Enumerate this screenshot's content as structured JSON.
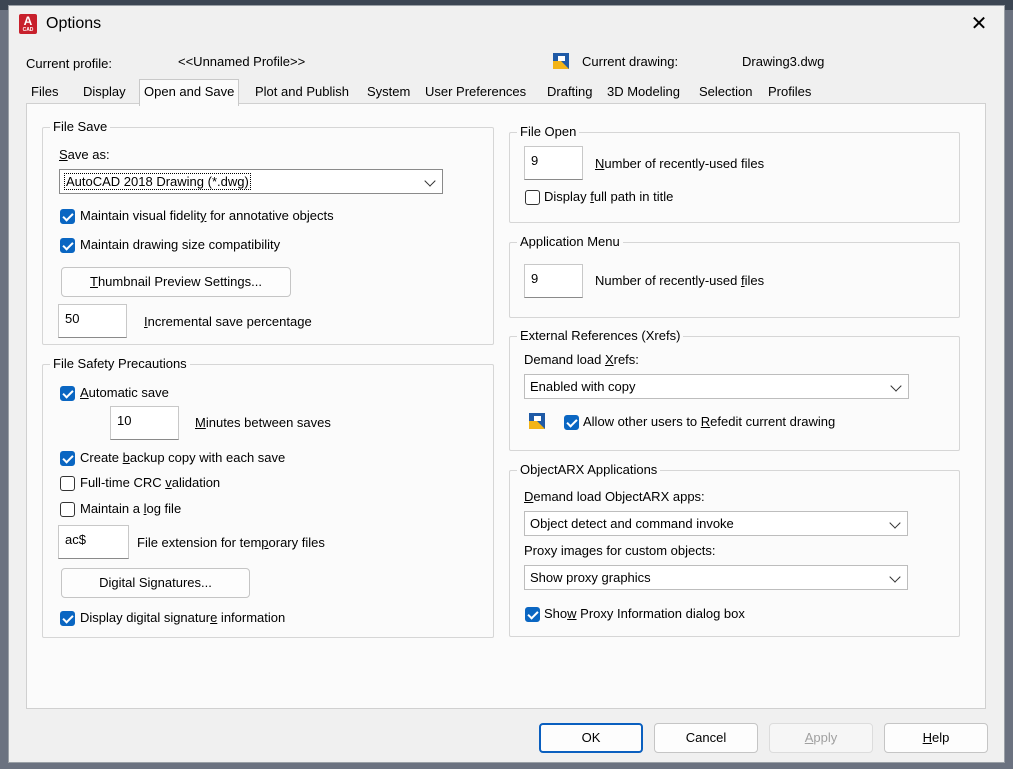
{
  "window": {
    "title": "Options",
    "app_icon_letter": "A",
    "app_icon_sub": "CAD",
    "close_glyph": "✕"
  },
  "header": {
    "current_profile_label": "Current profile:",
    "current_profile_value": "<<Unnamed Profile>>",
    "current_drawing_label": "Current drawing:",
    "current_drawing_value": "Drawing3.dwg"
  },
  "tabs": [
    {
      "label": "Files"
    },
    {
      "label": "Display"
    },
    {
      "label": "Open and Save",
      "active": true
    },
    {
      "label": "Plot and Publish"
    },
    {
      "label": "System"
    },
    {
      "label": "User Preferences"
    },
    {
      "label": "Drafting"
    },
    {
      "label": "3D Modeling"
    },
    {
      "label": "Selection"
    },
    {
      "label": "Profiles"
    }
  ],
  "file_save": {
    "legend": "File Save",
    "save_as_label": "<u>S</u>ave as:",
    "save_as_value": "AutoCAD 2018 Drawing (*.dwg)",
    "visual_fidelity": {
      "label": "Maintain visual fidelit<u>y</u> for annotative objects",
      "checked": true
    },
    "size_compat": {
      "label": "Maintain drawing size compatibility",
      "checked": true
    },
    "thumbnail_button": "<u>T</u>humbnail Preview Settings...",
    "incremental_value": "50",
    "incremental_label": "<u>I</u>ncremental save percentage"
  },
  "file_safety": {
    "legend": "File Safety Precautions",
    "automatic_save": {
      "label": "<u>A</u>utomatic save",
      "checked": true
    },
    "minutes_value": "10",
    "minutes_label": "<u>M</u>inutes between saves",
    "backup_copy": {
      "label": "Create <u>b</u>ackup copy with each save",
      "checked": true
    },
    "crc_validation": {
      "label": "Full-time CRC <u>v</u>alidation",
      "checked": false
    },
    "log_file": {
      "label": "Maintain a <u>l</u>og file",
      "checked": false
    },
    "temp_ext_value": "ac$",
    "temp_ext_label": "File extension for tem<u>p</u>orary files",
    "digital_signatures_button": "Digital Signatures...",
    "digital_sig_info": {
      "label": "Display digital signatur<u>e</u> information",
      "checked": true
    }
  },
  "file_open": {
    "legend": "File Open",
    "recent_value": "9",
    "recent_label": "<u>N</u>umber of recently-used files",
    "full_path": {
      "label": "Display <u>f</u>ull path in title",
      "checked": false
    }
  },
  "app_menu": {
    "legend": "Application Menu",
    "recent_value": "9",
    "recent_label": "Number of recently-used <u>f</u>iles"
  },
  "xrefs": {
    "legend": "External References (Xrefs)",
    "demand_label": "Demand load <u>X</u>refs:",
    "demand_value": "Enabled with copy",
    "refedit": {
      "label": "Allow other users to <u>R</u>efedit current drawing",
      "checked": true
    }
  },
  "objectarx": {
    "legend": "ObjectARX Applications",
    "demand_label": "<u>D</u>emand load ObjectARX apps:",
    "demand_value": "Object detect and command invoke",
    "proxy_label": "Proxy images for custom objects:",
    "proxy_value": "Show proxy graphics",
    "proxy_dialog": {
      "label": "Sho<u>w</u> Proxy Information dialog box",
      "checked": true
    }
  },
  "footer": {
    "ok": "OK",
    "cancel": "Cancel",
    "apply": "<u>A</u>pply",
    "help": "<u>H</u>elp"
  },
  "colors": {
    "accent": "#0a66c2",
    "app_icon": "#c8202c"
  }
}
